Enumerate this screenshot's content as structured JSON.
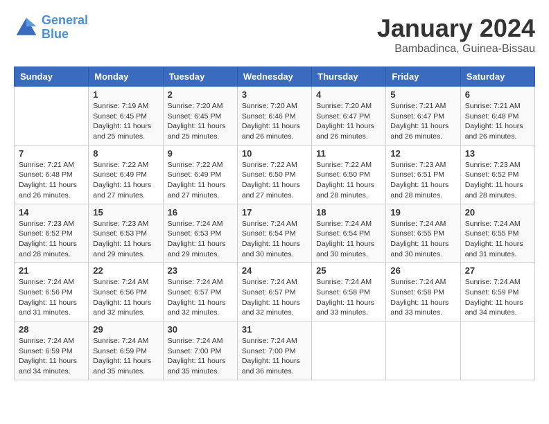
{
  "logo": {
    "line1": "General",
    "line2": "Blue"
  },
  "title": "January 2024",
  "location": "Bambadinca, Guinea-Bissau",
  "days_of_week": [
    "Sunday",
    "Monday",
    "Tuesday",
    "Wednesday",
    "Thursday",
    "Friday",
    "Saturday"
  ],
  "weeks": [
    [
      {
        "day": "",
        "info": ""
      },
      {
        "day": "1",
        "info": "Sunrise: 7:19 AM\nSunset: 6:45 PM\nDaylight: 11 hours\nand 25 minutes."
      },
      {
        "day": "2",
        "info": "Sunrise: 7:20 AM\nSunset: 6:45 PM\nDaylight: 11 hours\nand 25 minutes."
      },
      {
        "day": "3",
        "info": "Sunrise: 7:20 AM\nSunset: 6:46 PM\nDaylight: 11 hours\nand 26 minutes."
      },
      {
        "day": "4",
        "info": "Sunrise: 7:20 AM\nSunset: 6:47 PM\nDaylight: 11 hours\nand 26 minutes."
      },
      {
        "day": "5",
        "info": "Sunrise: 7:21 AM\nSunset: 6:47 PM\nDaylight: 11 hours\nand 26 minutes."
      },
      {
        "day": "6",
        "info": "Sunrise: 7:21 AM\nSunset: 6:48 PM\nDaylight: 11 hours\nand 26 minutes."
      }
    ],
    [
      {
        "day": "7",
        "info": "Sunrise: 7:21 AM\nSunset: 6:48 PM\nDaylight: 11 hours\nand 26 minutes."
      },
      {
        "day": "8",
        "info": "Sunrise: 7:22 AM\nSunset: 6:49 PM\nDaylight: 11 hours\nand 27 minutes."
      },
      {
        "day": "9",
        "info": "Sunrise: 7:22 AM\nSunset: 6:49 PM\nDaylight: 11 hours\nand 27 minutes."
      },
      {
        "day": "10",
        "info": "Sunrise: 7:22 AM\nSunset: 6:50 PM\nDaylight: 11 hours\nand 27 minutes."
      },
      {
        "day": "11",
        "info": "Sunrise: 7:22 AM\nSunset: 6:50 PM\nDaylight: 11 hours\nand 28 minutes."
      },
      {
        "day": "12",
        "info": "Sunrise: 7:23 AM\nSunset: 6:51 PM\nDaylight: 11 hours\nand 28 minutes."
      },
      {
        "day": "13",
        "info": "Sunrise: 7:23 AM\nSunset: 6:52 PM\nDaylight: 11 hours\nand 28 minutes."
      }
    ],
    [
      {
        "day": "14",
        "info": "Sunrise: 7:23 AM\nSunset: 6:52 PM\nDaylight: 11 hours\nand 28 minutes."
      },
      {
        "day": "15",
        "info": "Sunrise: 7:23 AM\nSunset: 6:53 PM\nDaylight: 11 hours\nand 29 minutes."
      },
      {
        "day": "16",
        "info": "Sunrise: 7:24 AM\nSunset: 6:53 PM\nDaylight: 11 hours\nand 29 minutes."
      },
      {
        "day": "17",
        "info": "Sunrise: 7:24 AM\nSunset: 6:54 PM\nDaylight: 11 hours\nand 30 minutes."
      },
      {
        "day": "18",
        "info": "Sunrise: 7:24 AM\nSunset: 6:54 PM\nDaylight: 11 hours\nand 30 minutes."
      },
      {
        "day": "19",
        "info": "Sunrise: 7:24 AM\nSunset: 6:55 PM\nDaylight: 11 hours\nand 30 minutes."
      },
      {
        "day": "20",
        "info": "Sunrise: 7:24 AM\nSunset: 6:55 PM\nDaylight: 11 hours\nand 31 minutes."
      }
    ],
    [
      {
        "day": "21",
        "info": "Sunrise: 7:24 AM\nSunset: 6:56 PM\nDaylight: 11 hours\nand 31 minutes."
      },
      {
        "day": "22",
        "info": "Sunrise: 7:24 AM\nSunset: 6:56 PM\nDaylight: 11 hours\nand 32 minutes."
      },
      {
        "day": "23",
        "info": "Sunrise: 7:24 AM\nSunset: 6:57 PM\nDaylight: 11 hours\nand 32 minutes."
      },
      {
        "day": "24",
        "info": "Sunrise: 7:24 AM\nSunset: 6:57 PM\nDaylight: 11 hours\nand 32 minutes."
      },
      {
        "day": "25",
        "info": "Sunrise: 7:24 AM\nSunset: 6:58 PM\nDaylight: 11 hours\nand 33 minutes."
      },
      {
        "day": "26",
        "info": "Sunrise: 7:24 AM\nSunset: 6:58 PM\nDaylight: 11 hours\nand 33 minutes."
      },
      {
        "day": "27",
        "info": "Sunrise: 7:24 AM\nSunset: 6:59 PM\nDaylight: 11 hours\nand 34 minutes."
      }
    ],
    [
      {
        "day": "28",
        "info": "Sunrise: 7:24 AM\nSunset: 6:59 PM\nDaylight: 11 hours\nand 34 minutes."
      },
      {
        "day": "29",
        "info": "Sunrise: 7:24 AM\nSunset: 6:59 PM\nDaylight: 11 hours\nand 35 minutes."
      },
      {
        "day": "30",
        "info": "Sunrise: 7:24 AM\nSunset: 7:00 PM\nDaylight: 11 hours\nand 35 minutes."
      },
      {
        "day": "31",
        "info": "Sunrise: 7:24 AM\nSunset: 7:00 PM\nDaylight: 11 hours\nand 36 minutes."
      },
      {
        "day": "",
        "info": ""
      },
      {
        "day": "",
        "info": ""
      },
      {
        "day": "",
        "info": ""
      }
    ]
  ]
}
